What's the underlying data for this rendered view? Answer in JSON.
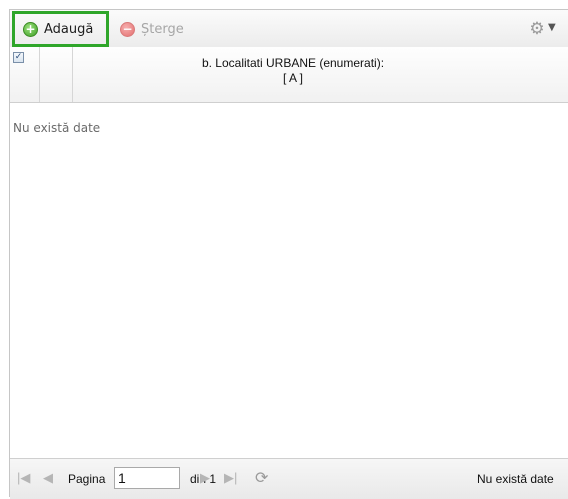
{
  "toolbar": {
    "add_label": "Adaugă",
    "delete_label": "Șterge",
    "add_icon": "plus-circle-icon",
    "delete_icon": "minus-circle-icon",
    "settings_icon": "gear-icon"
  },
  "grid": {
    "column_title_line1": "b. Localitati URBANE (enumerati):",
    "column_title_line2": "[ A ]",
    "empty_text": "Nu există date"
  },
  "pager": {
    "page_label": "Pagina",
    "page_value": "1",
    "of_label": "din 1",
    "status": "Nu există date"
  },
  "colors": {
    "highlight": "#2fa62a",
    "add_green": "#3f9f25",
    "delete_red": "#e25959"
  }
}
